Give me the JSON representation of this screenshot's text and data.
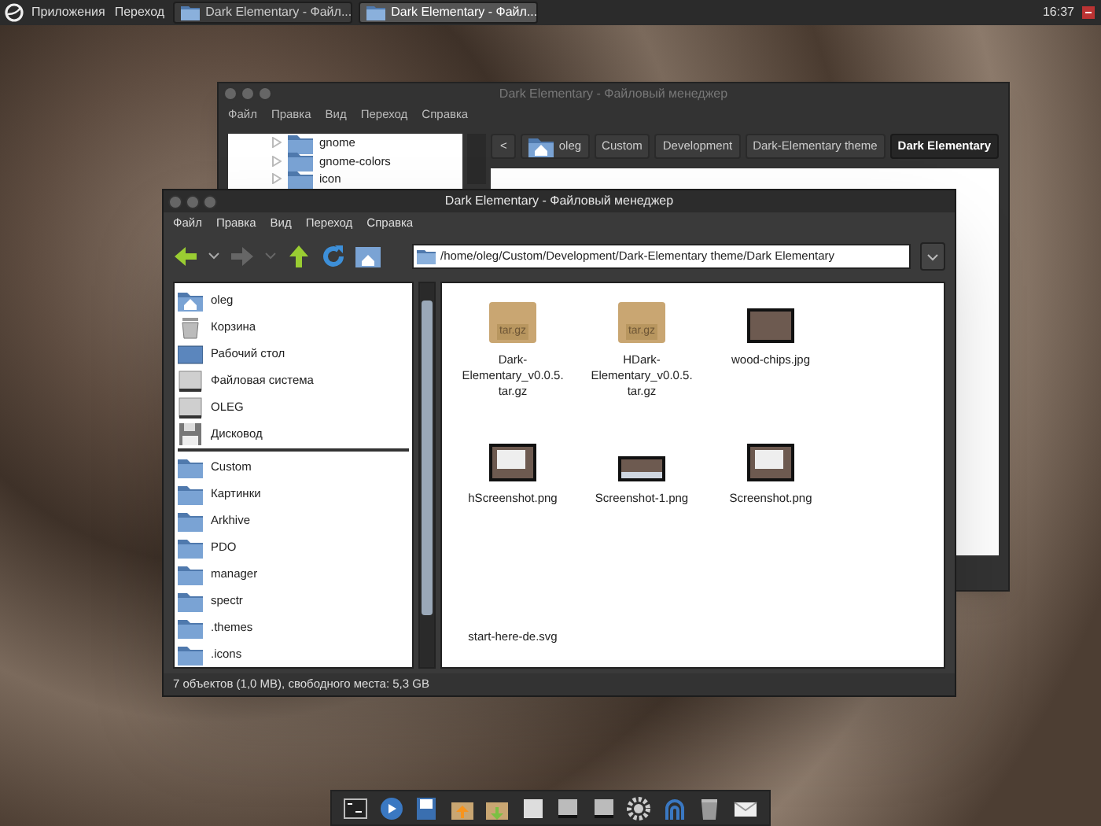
{
  "top_panel": {
    "menus": [
      "Приложения",
      "Переход"
    ],
    "tasks": [
      {
        "label": "Dark Elementary - Файл...",
        "selected": false
      },
      {
        "label": "Dark Elementary - Файл...",
        "selected": true
      }
    ],
    "clock": "16:37"
  },
  "back_window": {
    "title": "Dark Elementary - Файловый менеджер",
    "menu": [
      "Файл",
      "Правка",
      "Вид",
      "Переход",
      "Справка"
    ],
    "tree": [
      "gnome",
      "gnome-colors",
      "icon"
    ],
    "back_button": "<",
    "breadcrumb": [
      {
        "label": "oleg",
        "kind": "home",
        "selected": false
      },
      {
        "label": "Custom",
        "kind": "folder",
        "selected": false
      },
      {
        "label": "Development",
        "kind": "folder",
        "selected": false
      },
      {
        "label": "Dark-Elementary theme",
        "kind": "folder",
        "selected": false
      },
      {
        "label": "Dark Elementary",
        "kind": "folder",
        "selected": true
      }
    ]
  },
  "front_window": {
    "title": "Dark Elementary - Файловый менеджер",
    "menu": [
      "Файл",
      "Правка",
      "Вид",
      "Переход",
      "Справка"
    ],
    "path": "/home/oleg/Custom/Development/Dark-Elementary theme/Dark Elementary",
    "places": [
      {
        "label": "oleg",
        "kind": "home"
      },
      {
        "label": "Корзина",
        "kind": "trash"
      },
      {
        "label": "Рабочий стол",
        "kind": "desktop"
      },
      {
        "label": "Файловая система",
        "kind": "drive"
      },
      {
        "label": "OLEG",
        "kind": "drive"
      },
      {
        "label": "Дисковод",
        "kind": "floppy"
      }
    ],
    "bookmarks": [
      "Custom",
      "Картинки",
      "Arkhive",
      "PDO",
      "manager",
      "spectr",
      ".themes",
      ".icons"
    ],
    "files": [
      {
        "name": "Dark-Elementary_v0.0.5.tar.gz",
        "kind": "archive",
        "badge": "tar.gz"
      },
      {
        "name": "HDark-Elementary_v0.0.5.tar.gz",
        "kind": "archive",
        "badge": "tar.gz"
      },
      {
        "name": "wood-chips.jpg",
        "kind": "photo"
      },
      {
        "name": "hScreenshot.png",
        "kind": "screenshot"
      },
      {
        "name": "Screenshot-1.png",
        "kind": "wide-screenshot"
      },
      {
        "name": "Screenshot.png",
        "kind": "screenshot"
      },
      {
        "name": "start-here-de.svg",
        "kind": "blank"
      }
    ],
    "status": "7 объектов (1,0 MB), свободного места: 5,3 GB"
  }
}
